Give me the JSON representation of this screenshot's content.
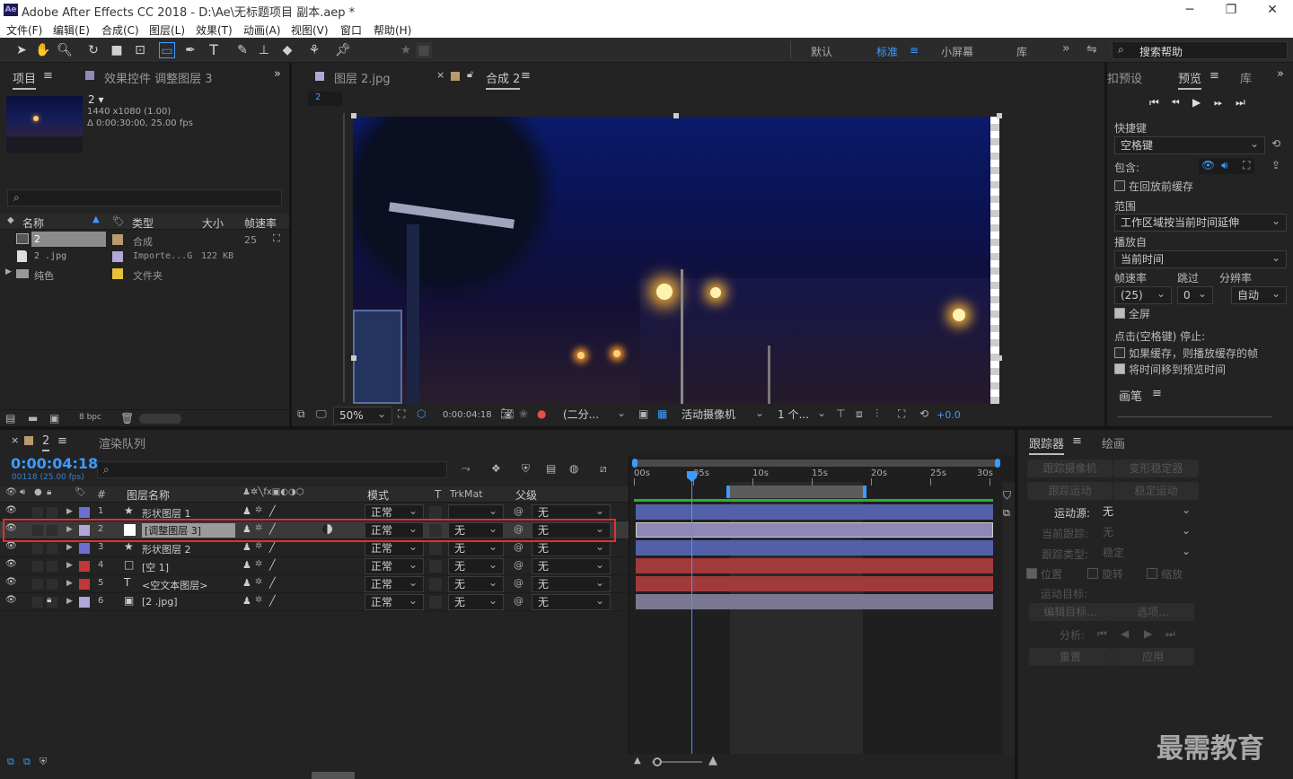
{
  "app": {
    "title": "Adobe After Effects CC 2018 - D:\\Ae\\无标题项目 副本.aep *",
    "logo": "Ae"
  },
  "menu": [
    "文件(F)",
    "编辑(E)",
    "合成(C)",
    "图层(L)",
    "效果(T)",
    "动画(A)",
    "视图(V)",
    "窗口",
    "帮助(H)"
  ],
  "workspaces": {
    "default": "默认",
    "standard": "标准",
    "small": "小屏幕",
    "library": "库",
    "more": "»",
    "search_placeholder": "搜索帮助"
  },
  "project": {
    "tab": "项目",
    "effects_tab": "效果控件 调整图层 3",
    "comp_name": "2 ▾",
    "comp_info": [
      "1440 x1080 (1.00)",
      "Δ 0:00:30:00, 25.00 fps"
    ],
    "columns": [
      "名称",
      "类型",
      "大小",
      "帧速率"
    ],
    "items": [
      {
        "name": "2",
        "type": "合成",
        "size": "",
        "fps": "25",
        "color": "#b79b6c"
      },
      {
        "name": "2 .jpg",
        "type": "Importe...G",
        "size": "122 KB",
        "fps": "",
        "color": "#b2a7d8"
      },
      {
        "name": "纯色",
        "type": "文件夹",
        "size": "",
        "fps": "",
        "color": "#e5c33a"
      }
    ],
    "bpc": "8 bpc"
  },
  "viewer": {
    "tab_layer": "图层 2.jpg",
    "tab_comp": "合成 2",
    "crumb": "2",
    "zoom": "50%",
    "timecode": "0:00:04:18",
    "resolution": "(二分...",
    "camera": "活动摄像机",
    "views": "1 个...",
    "exposure": "+0.0"
  },
  "preview": {
    "tab_presets": "扣预设",
    "tab": "预览",
    "tab_lib": "库",
    "shortcut_label": "快捷键",
    "shortcut": "空格键",
    "include": "包含:",
    "cache_before": "在回放前缓存",
    "range_label": "范围",
    "range": "工作区域按当前时间延伸",
    "play_from_label": "播放自",
    "play_from": "当前时间",
    "fps_label": "帧速率",
    "skip_label": "跳过",
    "res_label": "分辨率",
    "fps": "(25)",
    "skip": "0",
    "res": "自动",
    "fullscreen": "全屏",
    "stop_label": "点击(空格键) 停止:",
    "opt1": "如果缓存，则播放缓存的帧",
    "opt2": "将时间移到预览时间",
    "brush_tab": "画笔"
  },
  "timeline": {
    "tab": "2",
    "render_tab": "渲染队列",
    "time": "0:00:04:18",
    "frames": "00118 (25.00 fps)",
    "headers": {
      "num": "#",
      "name": "图层名称",
      "mode": "模式",
      "t": "T",
      "trkmat": "TrkMat",
      "parent": "父级"
    },
    "ruler": [
      "00s",
      "05s",
      "10s",
      "15s",
      "20s",
      "25s",
      "30s"
    ],
    "layers": [
      {
        "num": "1",
        "icon": "★",
        "name": "形状图层 1",
        "color": "#6c6fd0",
        "mode": "正常",
        "trk": "",
        "parent": "无",
        "bar": "#5360a8"
      },
      {
        "num": "2",
        "icon": "□",
        "name": "[调整图层 3]",
        "color": "#b2a7d8",
        "mode": "正常",
        "trk": "无",
        "parent": "无",
        "bar": "#8d88b6"
      },
      {
        "num": "3",
        "icon": "★",
        "name": "形状图层 2",
        "color": "#6c6fd0",
        "mode": "正常",
        "trk": "无",
        "parent": "无",
        "bar": "#5360a8"
      },
      {
        "num": "4",
        "icon": "□",
        "name": "[空 1]",
        "color": "#c03838",
        "mode": "正常",
        "trk": "无",
        "parent": "无",
        "bar": "#a13b3b"
      },
      {
        "num": "5",
        "icon": "T",
        "name": "<空文本图层>",
        "color": "#c03838",
        "mode": "正常",
        "trk": "无",
        "parent": "无",
        "bar": "#a13b3b"
      },
      {
        "num": "6",
        "icon": "▣",
        "name": "[2 .jpg]",
        "color": "#b2a7d8",
        "mode": "正常",
        "trk": "无",
        "parent": "无",
        "bar": "#7b7790"
      }
    ]
  },
  "tracker": {
    "tab": "跟踪器",
    "brush_tab": "绘画",
    "track_camera": "跟踪摄像机",
    "warp": "变形稳定器",
    "track_motion": "跟踪运动",
    "stabilize": "稳定运动",
    "source_label": "运动源:",
    "source": "无",
    "current_label": "当前跟踪:",
    "current": "无",
    "type_label": "跟踪类型:",
    "type": "稳定",
    "pos": "位置",
    "rot": "旋转",
    "scale": "缩放",
    "target_label": "运动目标:",
    "edit_target": "编辑目标...",
    "options": "选项...",
    "analyze": "分析:",
    "reset": "重置",
    "apply": "应用"
  },
  "watermark": "最需教育"
}
